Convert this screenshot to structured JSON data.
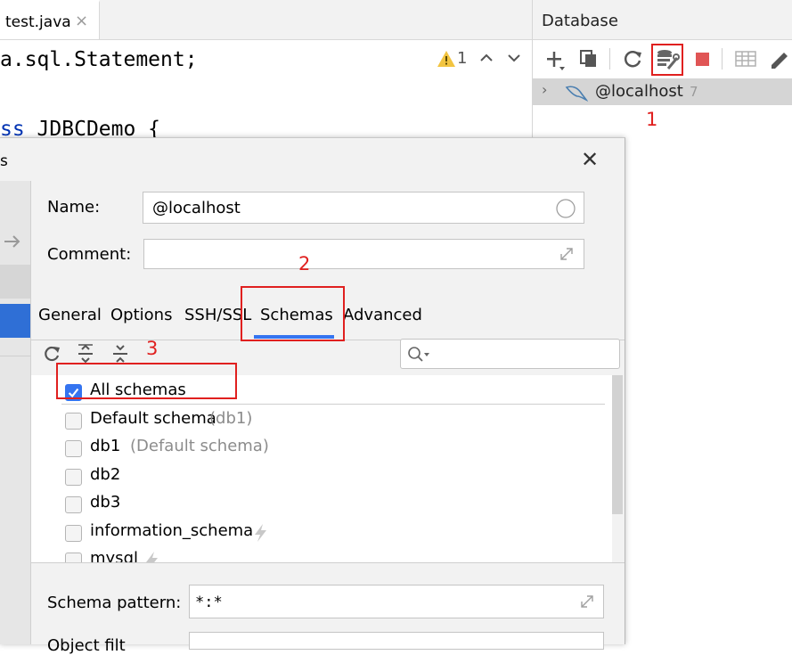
{
  "editor": {
    "tab_label": "test.java",
    "tab_close": "×",
    "code_lines": {
      "line1": "a.sql.Statement;",
      "line2_kw": "ss",
      "line2_rest": " JDBCDemo {"
    },
    "warning_count": "1",
    "nav_up": "⌃",
    "nav_down": "⌄"
  },
  "database_panel": {
    "title": "Database",
    "tree": {
      "arrow": "›",
      "host": "@localhost",
      "count": "7"
    }
  },
  "annotations": {
    "n1": "1",
    "n2": "2",
    "n3": "3",
    "color": "#e0201f"
  },
  "dialog": {
    "title_fragment": "s",
    "close": "✕",
    "name_label": "Name:",
    "name_value": "@localhost",
    "comment_label": "Comment:",
    "comment_value": "",
    "tabs": [
      "General",
      "Options",
      "SSH/SSL",
      "Schemas",
      "Advanced"
    ],
    "active_tab": "Schemas",
    "search_placeholder": "",
    "schemas": [
      {
        "label": "All schemas",
        "suffix": "",
        "checked": true,
        "bolt": false
      },
      {
        "label": "Default schema",
        "suffix": "(db1)",
        "checked": false,
        "bolt": false
      },
      {
        "label": "db1",
        "suffix": "(Default schema)",
        "checked": false,
        "bolt": false
      },
      {
        "label": "db2",
        "suffix": "",
        "checked": false,
        "bolt": false
      },
      {
        "label": "db3",
        "suffix": "",
        "checked": false,
        "bolt": false
      },
      {
        "label": "information_schema",
        "suffix": "",
        "checked": false,
        "bolt": true
      },
      {
        "label": "mysql",
        "suffix": "",
        "checked": false,
        "bolt": true
      }
    ],
    "schema_pattern_label": "Schema pattern:",
    "schema_pattern_value": "*:*",
    "object_filter_label": "Object filt"
  },
  "colors": {
    "accent": "#3574f0",
    "tab_underline": "#3574f0",
    "stop": "#e05555"
  }
}
